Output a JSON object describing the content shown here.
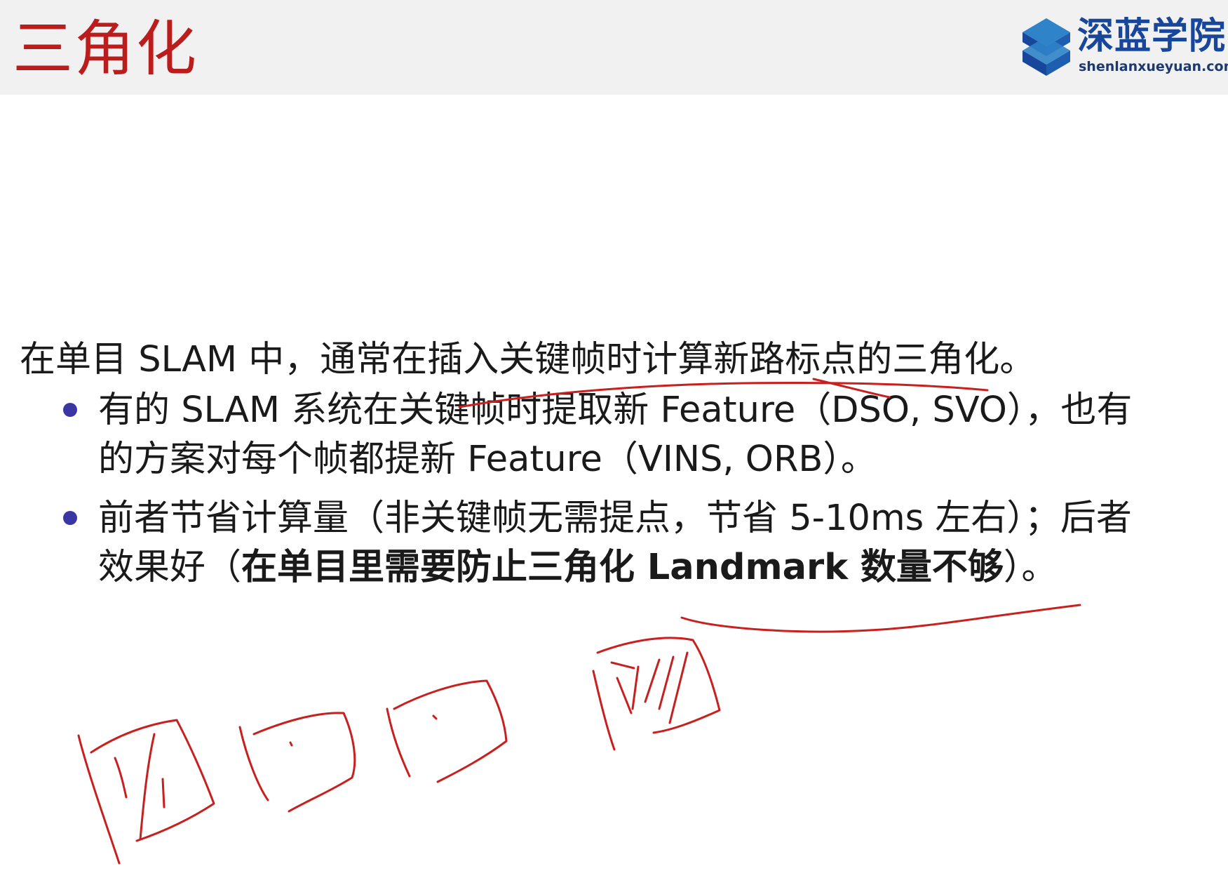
{
  "slide": {
    "title": "三角化"
  },
  "logo": {
    "name": "深蓝学院",
    "url": "shenlanxueyuan.com",
    "colors": {
      "dark": "#17469a",
      "light": "#2f83c9"
    }
  },
  "content": {
    "lead": "在单目 SLAM 中，通常在插入关键帧时计算新路标点的三角化。",
    "bullets": [
      {
        "line1": "有的 SLAM 系统在关键帧时提取新 Feature（DSO, SVO），也有",
        "line2": "的方案对每个帧都提新 Feature（VINS, ORB）。"
      },
      {
        "line1": "前者节省计算量（非关键帧无需提点，节省 5-10ms 左右）；后者",
        "line2_prefix": "效果好（",
        "line2_bold": "在单目里需要防止三角化 Landmark 数量不够",
        "line2_suffix": "）。"
      }
    ]
  },
  "colors": {
    "title": "#bb1d1d",
    "bullet": "#3a37a5",
    "annotation_ink": "#c8201f",
    "header_bg": "#f1f1f1"
  }
}
